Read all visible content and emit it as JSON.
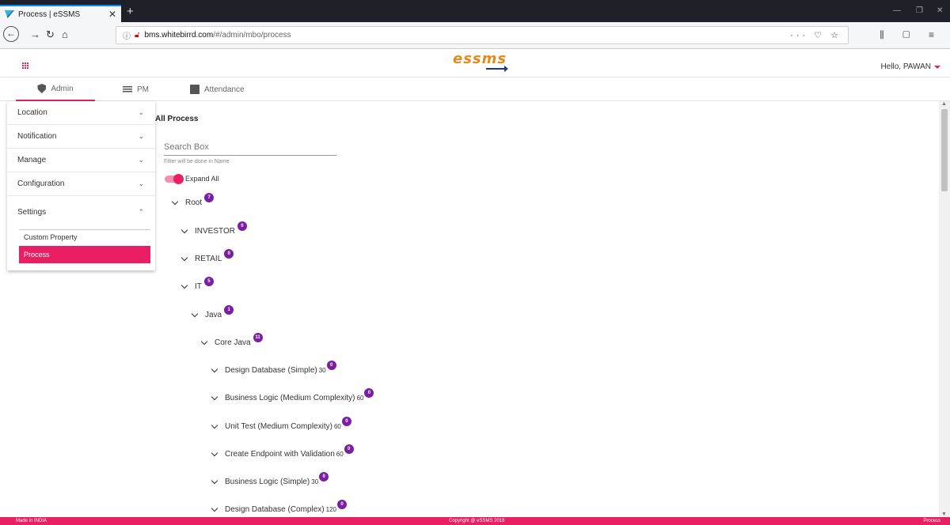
{
  "browser": {
    "tab_title": "Process | eSSMS",
    "tab_close": "✕",
    "new_tab": "+",
    "url_host": "bms.whitebirrd.com",
    "url_path": "/#/admin/mbo/process",
    "url_actions": "··· ♡ ☆",
    "win_min": "—",
    "win_max": "❐",
    "win_close": "✕",
    "tool_icons": "⫼ ▢ ≡"
  },
  "header": {
    "logo": "essms",
    "greeting": "Hello, PAWAN"
  },
  "top_tabs": [
    {
      "label": "Admin"
    },
    {
      "label": "PM"
    },
    {
      "label": "Attendance"
    }
  ],
  "sidebar": {
    "items": [
      {
        "label": "Location",
        "chevron": "⌄"
      },
      {
        "label": "Notification",
        "chevron": "⌄"
      },
      {
        "label": "Manage",
        "chevron": "⌄"
      },
      {
        "label": "Configuration",
        "chevron": "⌄"
      },
      {
        "label": "Settings",
        "chevron": "⌃"
      }
    ],
    "sub_items": [
      {
        "label": "Custom Property"
      },
      {
        "label": "Process"
      }
    ]
  },
  "main": {
    "title": "All Process",
    "search_placeholder": "Search Box",
    "search_hint": "Filter will be done in Name",
    "expand_all_label": "Expand All",
    "expand_all_on": true,
    "tree": [
      {
        "label": "Root",
        "num": "",
        "badge": "7"
      },
      {
        "label": "INVESTOR",
        "num": "",
        "badge": "0"
      },
      {
        "label": "RETAIL",
        "num": "",
        "badge": "0"
      },
      {
        "label": "IT",
        "num": "",
        "badge": "5"
      },
      {
        "label": "Java",
        "num": "",
        "badge": "1"
      },
      {
        "label": "Core Java",
        "num": "",
        "badge": "11"
      },
      {
        "label": "Design Database (Simple)",
        "num": "30",
        "badge": "0"
      },
      {
        "label": "Business Logic (Medium Complexity)",
        "num": "60",
        "badge": "0"
      },
      {
        "label": "Unit Test (Medium Complexity)",
        "num": "60",
        "badge": "0"
      },
      {
        "label": "Create Endpoint with Validation",
        "num": "60",
        "badge": "0"
      },
      {
        "label": "Business Logic (Simple)",
        "num": "30",
        "badge": "0"
      },
      {
        "label": "Design Database (Complex)",
        "num": "120",
        "badge": "0"
      }
    ]
  },
  "scroll": {
    "up": "▲",
    "down": "▼"
  },
  "footer": {
    "left": "Made in INDIA",
    "center": "Copyright @ eSSMS 2018",
    "right": "Process"
  },
  "colors": {
    "accent": "#e91e63",
    "badge": "#7b1fa2",
    "logo": "#e48a1b"
  }
}
